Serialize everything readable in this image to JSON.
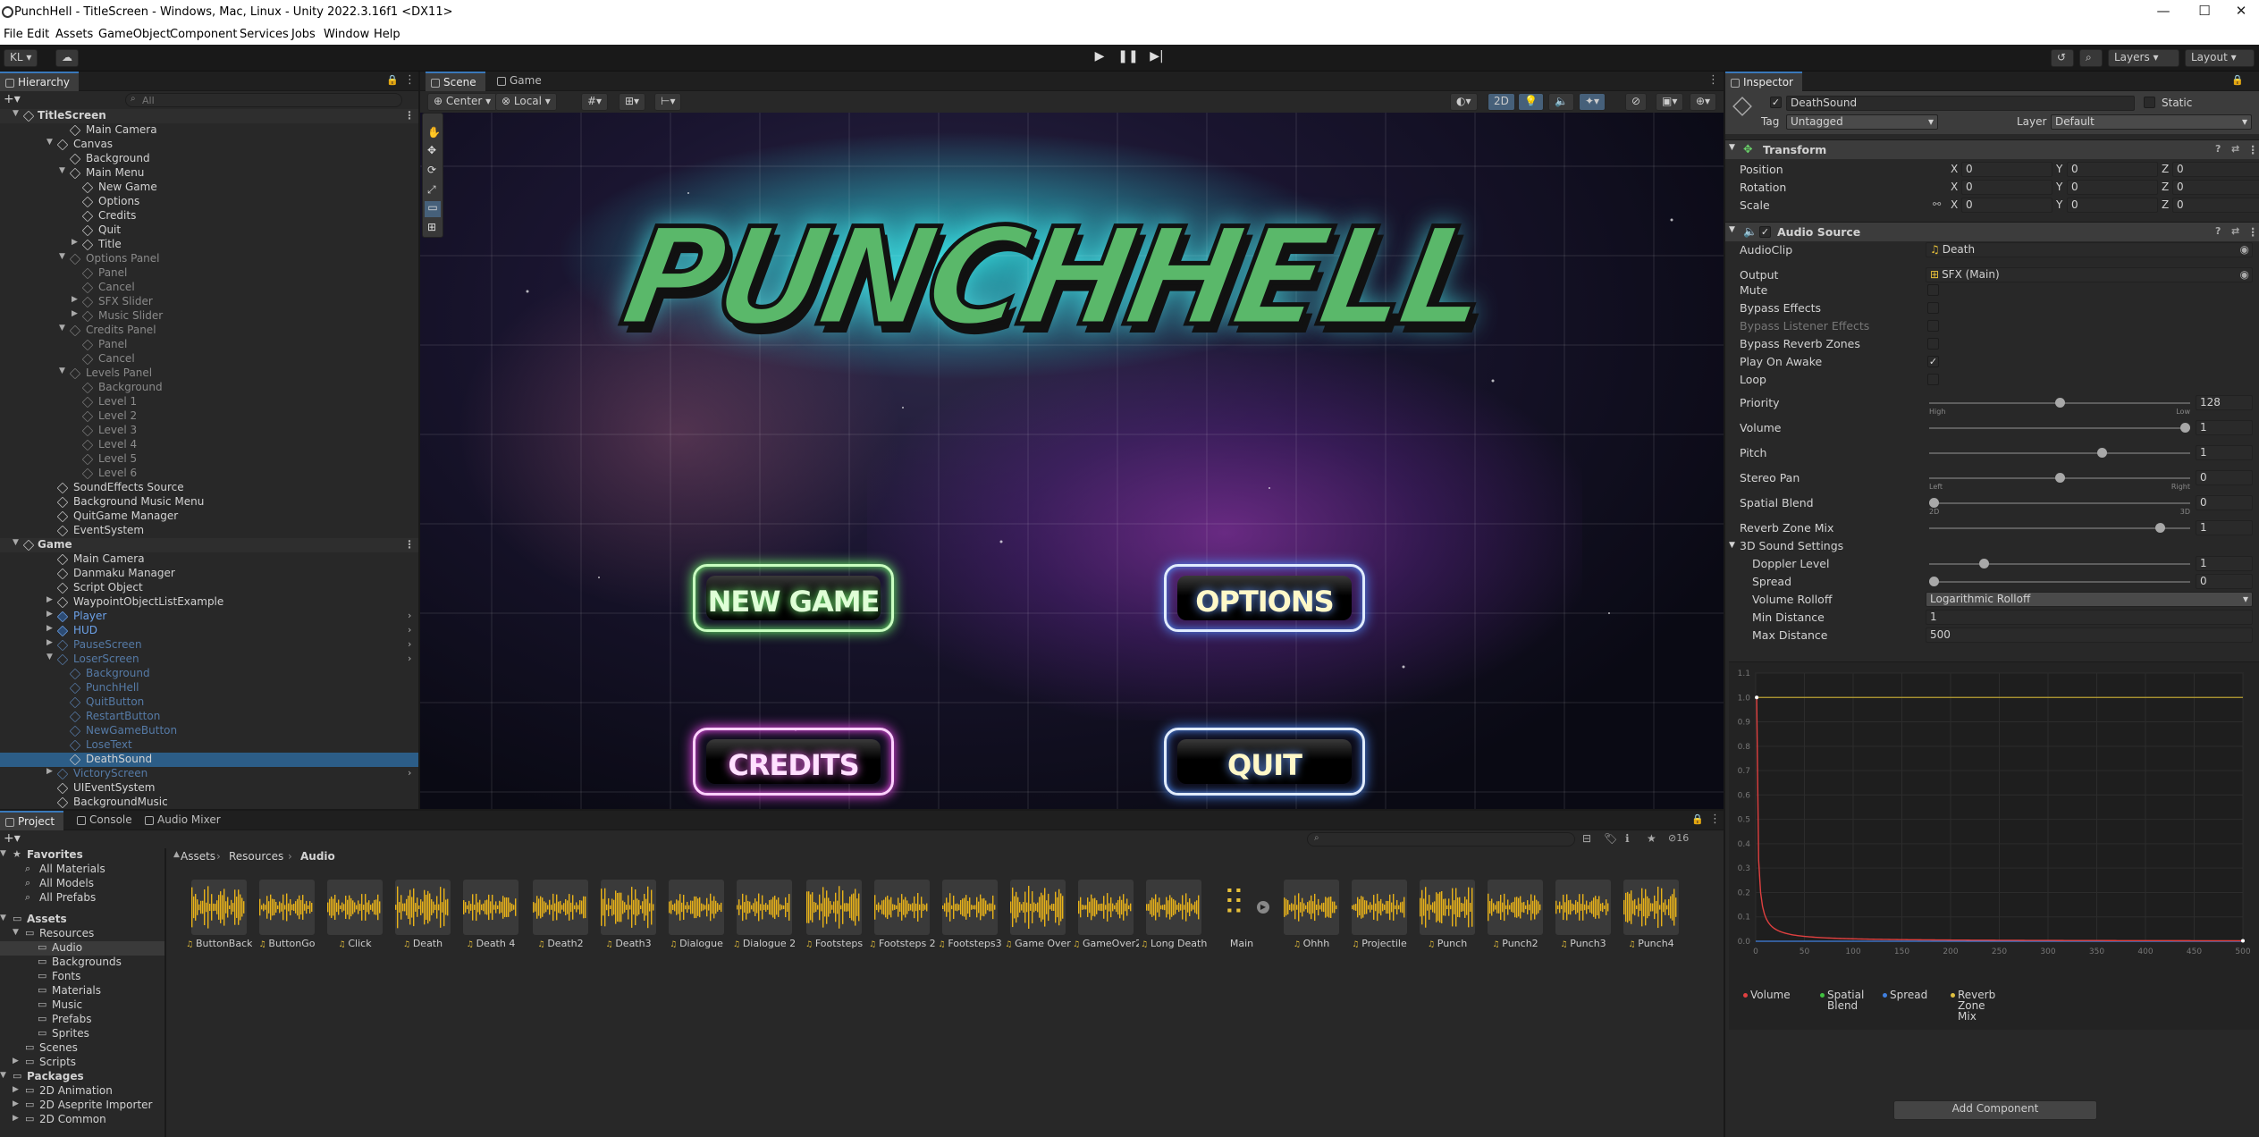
{
  "window": {
    "title": "PunchHell - TitleScreen - Windows, Mac, Linux - Unity 2022.3.16f1 <DX11>"
  },
  "menu": [
    "File",
    "Edit",
    "Assets",
    "GameObject",
    "Component",
    "Services",
    "Jobs",
    "Window",
    "Help"
  ],
  "toolbar": {
    "account": "KL",
    "layers": "Layers",
    "layout": "Layout"
  },
  "hierarchy": {
    "tab": "Hierarchy",
    "search_placeholder": "All",
    "rows": [
      {
        "label": "TitleScreen",
        "indent": 0,
        "arrow": "▼",
        "style": "scene"
      },
      {
        "label": "Main Camera",
        "indent": 2,
        "arrow": "",
        "style": ""
      },
      {
        "label": "Canvas",
        "indent": 1,
        "arrow": "▼",
        "style": ""
      },
      {
        "label": "Background",
        "indent": 2,
        "arrow": "",
        "style": ""
      },
      {
        "label": "Main Menu",
        "indent": 2,
        "arrow": "▼",
        "style": ""
      },
      {
        "label": "New Game",
        "indent": 3,
        "arrow": "",
        "style": ""
      },
      {
        "label": "Options",
        "indent": 3,
        "arrow": "",
        "style": ""
      },
      {
        "label": "Credits",
        "indent": 3,
        "arrow": "",
        "style": ""
      },
      {
        "label": "Quit",
        "indent": 3,
        "arrow": "",
        "style": ""
      },
      {
        "label": "Title",
        "indent": 3,
        "arrow": "▶",
        "style": ""
      },
      {
        "label": "Options Panel",
        "indent": 2,
        "arrow": "▼",
        "style": "dim"
      },
      {
        "label": "Panel",
        "indent": 3,
        "arrow": "",
        "style": "dim"
      },
      {
        "label": "Cancel",
        "indent": 3,
        "arrow": "",
        "style": "dim"
      },
      {
        "label": "SFX Slider",
        "indent": 3,
        "arrow": "▶",
        "style": "dim"
      },
      {
        "label": "Music Slider",
        "indent": 3,
        "arrow": "▶",
        "style": "dim"
      },
      {
        "label": "Credits Panel",
        "indent": 2,
        "arrow": "▼",
        "style": "dim"
      },
      {
        "label": "Panel",
        "indent": 3,
        "arrow": "",
        "style": "dim"
      },
      {
        "label": "Cancel",
        "indent": 3,
        "arrow": "",
        "style": "dim"
      },
      {
        "label": "Levels Panel",
        "indent": 2,
        "arrow": "▼",
        "style": "dim"
      },
      {
        "label": "Background",
        "indent": 3,
        "arrow": "",
        "style": "dim"
      },
      {
        "label": "Level 1",
        "indent": 3,
        "arrow": "",
        "style": "dim"
      },
      {
        "label": "Level 2",
        "indent": 3,
        "arrow": "",
        "style": "dim"
      },
      {
        "label": "Level 3",
        "indent": 3,
        "arrow": "",
        "style": "dim"
      },
      {
        "label": "Level 4",
        "indent": 3,
        "arrow": "",
        "style": "dim"
      },
      {
        "label": "Level 5",
        "indent": 3,
        "arrow": "",
        "style": "dim"
      },
      {
        "label": "Level 6",
        "indent": 3,
        "arrow": "",
        "style": "dim"
      },
      {
        "label": "SoundEffects Source",
        "indent": 1,
        "arrow": "",
        "style": ""
      },
      {
        "label": "Background Music Menu",
        "indent": 1,
        "arrow": "",
        "style": ""
      },
      {
        "label": "QuitGame Manager",
        "indent": 1,
        "arrow": "",
        "style": ""
      },
      {
        "label": "EventSystem",
        "indent": 1,
        "arrow": "",
        "style": ""
      },
      {
        "label": "Game",
        "indent": 0,
        "arrow": "▼",
        "style": "scene"
      },
      {
        "label": "Main Camera",
        "indent": 1,
        "arrow": "",
        "style": ""
      },
      {
        "label": "Danmaku Manager",
        "indent": 1,
        "arrow": "",
        "style": ""
      },
      {
        "label": "Script Object",
        "indent": 1,
        "arrow": "",
        "style": ""
      },
      {
        "label": "WaypointObjectListExample",
        "indent": 1,
        "arrow": "▶",
        "style": ""
      },
      {
        "label": "Player",
        "indent": 1,
        "arrow": "▶",
        "style": "blue"
      },
      {
        "label": "HUD",
        "indent": 1,
        "arrow": "▶",
        "style": "blue"
      },
      {
        "label": "PauseScreen",
        "indent": 1,
        "arrow": "▶",
        "style": "dimblue"
      },
      {
        "label": "LoserScreen",
        "indent": 1,
        "arrow": "▼",
        "style": "dimblue"
      },
      {
        "label": "Background",
        "indent": 2,
        "arrow": "",
        "style": "dimblue"
      },
      {
        "label": "PunchHell",
        "indent": 2,
        "arrow": "",
        "style": "dimblue"
      },
      {
        "label": "QuitButton",
        "indent": 2,
        "arrow": "",
        "style": "dimblue"
      },
      {
        "label": "RestartButton",
        "indent": 2,
        "arrow": "",
        "style": "dimblue"
      },
      {
        "label": "NewGameButton",
        "indent": 2,
        "arrow": "",
        "style": "dimblue"
      },
      {
        "label": "LoseText",
        "indent": 2,
        "arrow": "",
        "style": "dimblue"
      },
      {
        "label": "DeathSound",
        "indent": 2,
        "arrow": "",
        "style": "sel"
      },
      {
        "label": "VictoryScreen",
        "indent": 1,
        "arrow": "▶",
        "style": "dimblue"
      },
      {
        "label": "UIEventSystem",
        "indent": 1,
        "arrow": "",
        "style": ""
      },
      {
        "label": "BackgroundMusic",
        "indent": 1,
        "arrow": "",
        "style": ""
      }
    ]
  },
  "scene": {
    "tabs": [
      "Scene",
      "Game"
    ],
    "pivot": "Center",
    "space": "Local",
    "mode2d": "2D",
    "logo": "PUNCHHELL",
    "buttons": {
      "new_game": "NEW GAME",
      "options": "OPTIONS",
      "credits": "CREDITS",
      "quit": "QUIT"
    }
  },
  "inspector": {
    "tab": "Inspector",
    "object_name": "DeathSound",
    "static_label": "Static",
    "tag_label": "Tag",
    "tag_value": "Untagged",
    "layer_label": "Layer",
    "layer_value": "Default",
    "transform": {
      "title": "Transform",
      "position_label": "Position",
      "rotation_label": "Rotation",
      "scale_label": "Scale",
      "x": "X",
      "y": "Y",
      "z": "Z",
      "position": [
        "0",
        "0",
        "0"
      ],
      "rotation": [
        "0",
        "0",
        "0"
      ],
      "scale": [
        "0",
        "0",
        "0"
      ]
    },
    "audio": {
      "title": "Audio Source",
      "clip_label": "AudioClip",
      "clip_value": "Death",
      "output_label": "Output",
      "output_value": "SFX (Main)",
      "mute": "Mute",
      "bypass_effects": "Bypass Effects",
      "bypass_listener": "Bypass Listener Effects",
      "bypass_reverb": "Bypass Reverb Zones",
      "play_on_awake": "Play On Awake",
      "loop": "Loop",
      "priority_label": "Priority",
      "priority_value": "128",
      "priority_fraction": 0.5,
      "high": "High",
      "low": "Low",
      "volume_label": "Volume",
      "volume_value": "1",
      "volume_fraction": 1,
      "pitch_label": "Pitch",
      "pitch_value": "1",
      "pitch_fraction": 0.67,
      "stereo_label": "Stereo Pan",
      "stereo_value": "0",
      "stereo_fraction": 0.5,
      "left": "Left",
      "right": "Right",
      "spatial_label": "Spatial Blend",
      "spatial_value": "0",
      "spatial_fraction": 0,
      "twod": "2D",
      "threed": "3D",
      "reverb_label": "Reverb Zone Mix",
      "reverb_value": "1",
      "reverb_fraction": 0.9,
      "settings3d": "3D Sound Settings",
      "doppler_label": "Doppler Level",
      "doppler_value": "1",
      "doppler_fraction": 0.2,
      "spread_label": "Spread",
      "spread_value": "0",
      "spread_fraction": 0,
      "rolloff_label": "Volume Rolloff",
      "rolloff_value": "Logarithmic Rolloff",
      "min_label": "Min Distance",
      "min_value": "1",
      "max_label": "Max Distance",
      "max_value": "500"
    },
    "graph": {
      "y_ticks": [
        "1.1",
        "1.0",
        "0.9",
        "0.8",
        "0.7",
        "0.6",
        "0.5",
        "0.4",
        "0.3",
        "0.2",
        "0.1",
        "0.0"
      ],
      "x_ticks": [
        "0",
        "50",
        "100",
        "150",
        "200",
        "250",
        "300",
        "350",
        "400",
        "450",
        "500"
      ],
      "legend": [
        {
          "name": "Volume",
          "color": "#e04040"
        },
        {
          "name": "Spatial Blend",
          "color": "#40c040"
        },
        {
          "name": "Spread",
          "color": "#4080e0"
        },
        {
          "name": "Reverb Zone Mix",
          "color": "#e0c040"
        }
      ]
    },
    "add_component": "Add Component"
  },
  "project": {
    "tabs": [
      "Project",
      "Console",
      "Audio Mixer"
    ],
    "count": "16",
    "breadcrumb": [
      "Assets",
      "Resources",
      "Audio"
    ],
    "favorites": "Favorites",
    "fav_items": [
      "All Materials",
      "All Models",
      "All Prefabs"
    ],
    "assets_root": "Assets",
    "tree": [
      {
        "label": "Resources",
        "indent": 1,
        "arrow": "▼"
      },
      {
        "label": "Audio",
        "indent": 2,
        "arrow": "",
        "sel": true
      },
      {
        "label": "Backgrounds",
        "indent": 2,
        "arrow": ""
      },
      {
        "label": "Fonts",
        "indent": 2,
        "arrow": ""
      },
      {
        "label": "Materials",
        "indent": 2,
        "arrow": ""
      },
      {
        "label": "Music",
        "indent": 2,
        "arrow": ""
      },
      {
        "label": "Prefabs",
        "indent": 2,
        "arrow": ""
      },
      {
        "label": "Sprites",
        "indent": 2,
        "arrow": ""
      },
      {
        "label": "Scenes",
        "indent": 1,
        "arrow": ""
      },
      {
        "label": "Scripts",
        "indent": 1,
        "arrow": "▶"
      }
    ],
    "packages_root": "Packages",
    "packages": [
      "2D Animation",
      "2D Aseprite Importer",
      "2D Common"
    ],
    "assets": [
      "ButtonBack",
      "ButtonGo",
      "Click",
      "Death",
      "Death 4",
      "Death2",
      "Death3",
      "Dialogue",
      "Dialogue 2",
      "Footsteps",
      "Footsteps 2",
      "Footsteps3",
      "Game Over",
      "GameOver2",
      "Long Death",
      "Main",
      "Ohhh",
      "Projectile",
      "Punch",
      "Punch2",
      "Punch3",
      "Punch4"
    ]
  }
}
